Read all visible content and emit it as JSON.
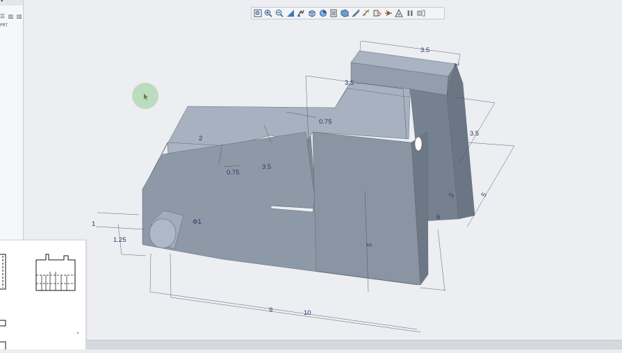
{
  "left_panel": {
    "icons_text": "☰ ▥ ▥",
    "label": "PRT"
  },
  "toolbar": {
    "buttons": [
      {
        "name": "zoom-fit-icon"
      },
      {
        "name": "zoom-in-icon"
      },
      {
        "name": "zoom-out-icon"
      },
      {
        "name": "repaint-icon"
      },
      {
        "name": "pan-icon"
      },
      {
        "name": "view-cube-icon"
      },
      {
        "name": "saved-views-icon"
      },
      {
        "name": "layers-icon"
      },
      {
        "name": "display-style-icon"
      },
      {
        "name": "datum-display-icon"
      },
      {
        "name": "sketch-icon"
      },
      {
        "name": "annotation-icon"
      },
      {
        "name": "spin-center-icon"
      },
      {
        "name": "section-icon"
      },
      {
        "name": "pause-icon"
      },
      {
        "name": "next-icon"
      }
    ]
  },
  "dimensions": {
    "d_top_width": "3.5",
    "d_mid_width": "3.5",
    "d_top_height": "3",
    "d_right_depth": "3.5",
    "d_right_5": "5",
    "d_right_3": "3",
    "d_right_6": "6",
    "d_slot_width": "2",
    "d_slot_depth": "0.75",
    "d_pocket": "3.5",
    "d_075b": "0.75",
    "d_phi": "Φ1",
    "d_left_1": "1",
    "d_left_125": "1.25",
    "d_front_5": "5",
    "d_bottom_9": "9",
    "d_bottom_10": "10"
  },
  "colors": {
    "background": "#eceef2",
    "face_top": "#a7b1bf",
    "face_front": "#8d98a6",
    "face_side": "#6f7b89",
    "dimension": "#34306a"
  }
}
